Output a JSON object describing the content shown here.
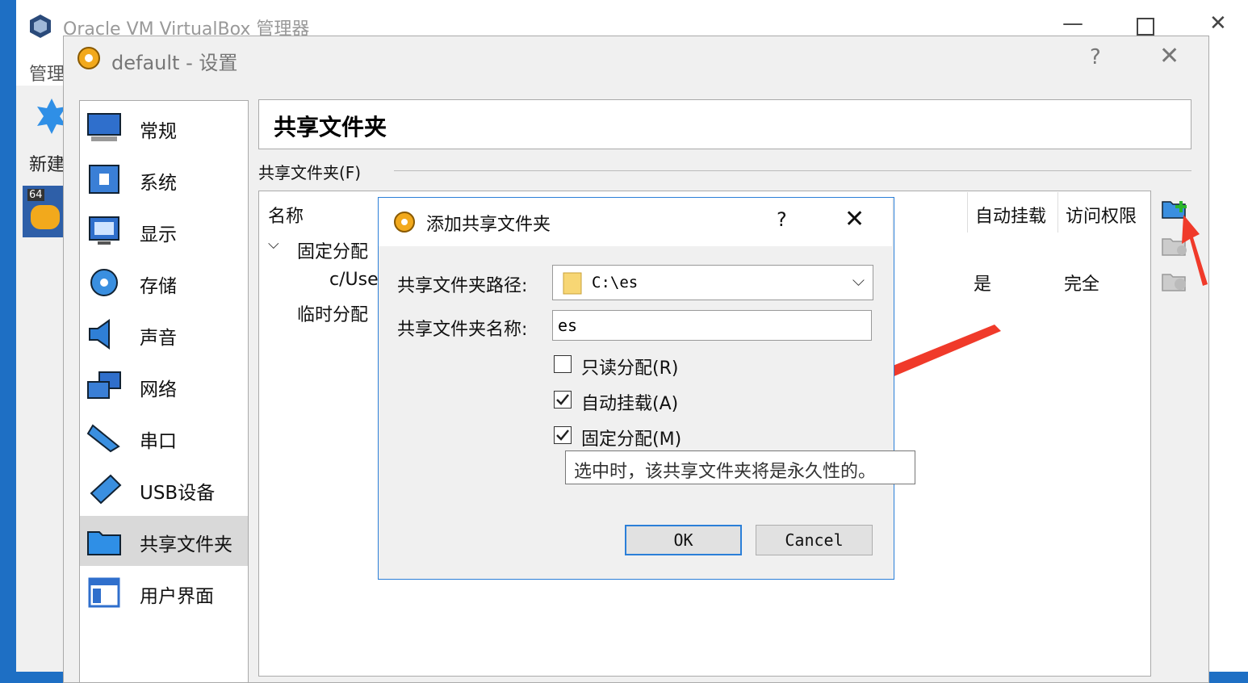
{
  "manager": {
    "title": "Oracle VM VirtualBox 管理器",
    "menu_label": "管理",
    "new_label": "新建"
  },
  "settings": {
    "title": "default - 设置",
    "help": "?",
    "close": "✕",
    "nav": [
      {
        "label": "常规",
        "icon": "general-icon"
      },
      {
        "label": "系统",
        "icon": "system-icon"
      },
      {
        "label": "显示",
        "icon": "display-icon"
      },
      {
        "label": "存储",
        "icon": "storage-icon"
      },
      {
        "label": "声音",
        "icon": "audio-icon"
      },
      {
        "label": "网络",
        "icon": "network-icon"
      },
      {
        "label": "串口",
        "icon": "serial-port-icon"
      },
      {
        "label": "USB设备",
        "icon": "usb-icon"
      },
      {
        "label": "共享文件夹",
        "icon": "shared-folder-icon",
        "selected": true
      },
      {
        "label": "用户界面",
        "icon": "user-interface-icon"
      }
    ],
    "page_title": "共享文件夹",
    "group_label": "共享文件夹(F)",
    "table": {
      "headers": [
        "名称",
        "自动挂载",
        "访问权限"
      ],
      "group1": "固定分配",
      "row_path": "c/Use",
      "row_auto": "是",
      "row_access": "完全",
      "group2": "临时分配"
    }
  },
  "add_dialog": {
    "title": "添加共享文件夹",
    "help": "?",
    "close": "✕",
    "path_label": "共享文件夹路径:",
    "path_value": "C:\\es",
    "name_label": "共享文件夹名称:",
    "name_value": "es",
    "readonly_label": "只读分配(R)",
    "automount_label": "自动挂载(A)",
    "permanent_label": "固定分配(M)",
    "readonly_checked": false,
    "automount_checked": true,
    "permanent_checked": true,
    "tooltip": "选中时，该共享文件夹将是永久性的。",
    "ok": "OK",
    "cancel": "Cancel"
  },
  "colors": {
    "accent": "#2b7fd8",
    "arrow": "#f03a2a"
  }
}
